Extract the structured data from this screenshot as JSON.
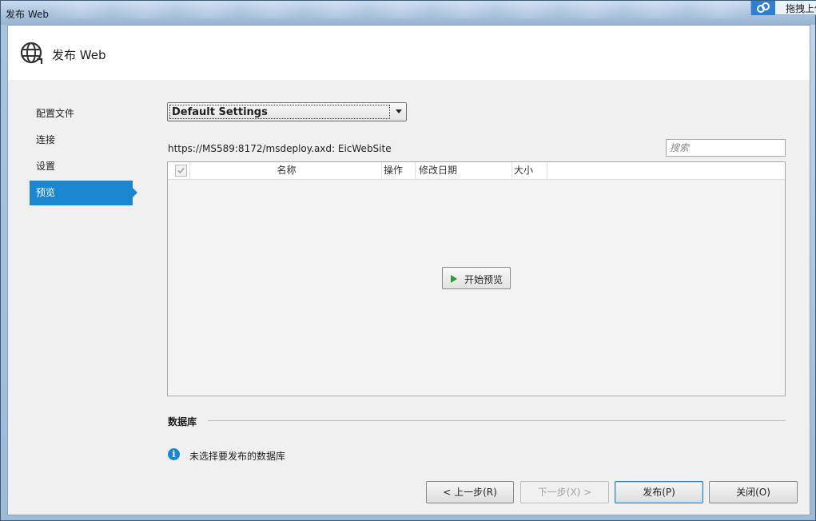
{
  "window": {
    "title": "发布 Web"
  },
  "upload_chip": {
    "label": "拖拽上传",
    "icon": "cloud-upload-icon"
  },
  "header": {
    "title": "发布 Web",
    "icon": "globe-icon"
  },
  "sidebar": {
    "items": [
      {
        "label": "配置文件",
        "active": false
      },
      {
        "label": "连接",
        "active": false
      },
      {
        "label": "设置",
        "active": false
      },
      {
        "label": "预览",
        "active": true
      }
    ]
  },
  "profile": {
    "selected": "Default Settings"
  },
  "target_url": "https://MS589:8172/msdeploy.axd: EicWebSite",
  "search": {
    "placeholder": "搜索",
    "value": ""
  },
  "grid": {
    "columns": [
      "名称",
      "操作",
      "修改日期",
      "大小"
    ],
    "header_checked": true,
    "rows": [],
    "start_preview_label": "开始预览"
  },
  "database": {
    "section_title": "数据库",
    "message": "未选择要发布的数据库"
  },
  "buttons": {
    "prev": "< 上一步(R)",
    "next": "下一步(X) >",
    "publish": "发布(P)",
    "close": "关闭(O)"
  },
  "colors": {
    "accent": "#1a86d0",
    "play_green": "#2a9a3a",
    "window_frame": "#a9c4e0"
  }
}
